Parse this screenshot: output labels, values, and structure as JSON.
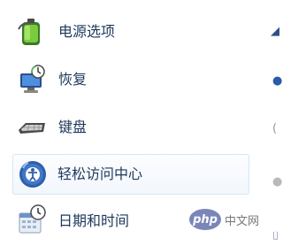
{
  "items": [
    {
      "id": "power",
      "label": "电源选项",
      "icon": "battery-power-icon"
    },
    {
      "id": "recovery",
      "label": "恢复",
      "icon": "computer-restore-icon"
    },
    {
      "id": "keyboard",
      "label": "键盘",
      "icon": "keyboard-icon"
    },
    {
      "id": "ease",
      "label": "轻松访问中心",
      "icon": "ease-of-access-icon",
      "selected": true
    },
    {
      "id": "datetime",
      "label": "日期和时间",
      "icon": "calendar-clock-icon"
    }
  ],
  "watermark": {
    "logo": "php",
    "text": "中文网"
  },
  "colors": {
    "label": "#1e395b",
    "selected_border": "#d6e6f5",
    "selected_bg": "#f2f7fd"
  }
}
